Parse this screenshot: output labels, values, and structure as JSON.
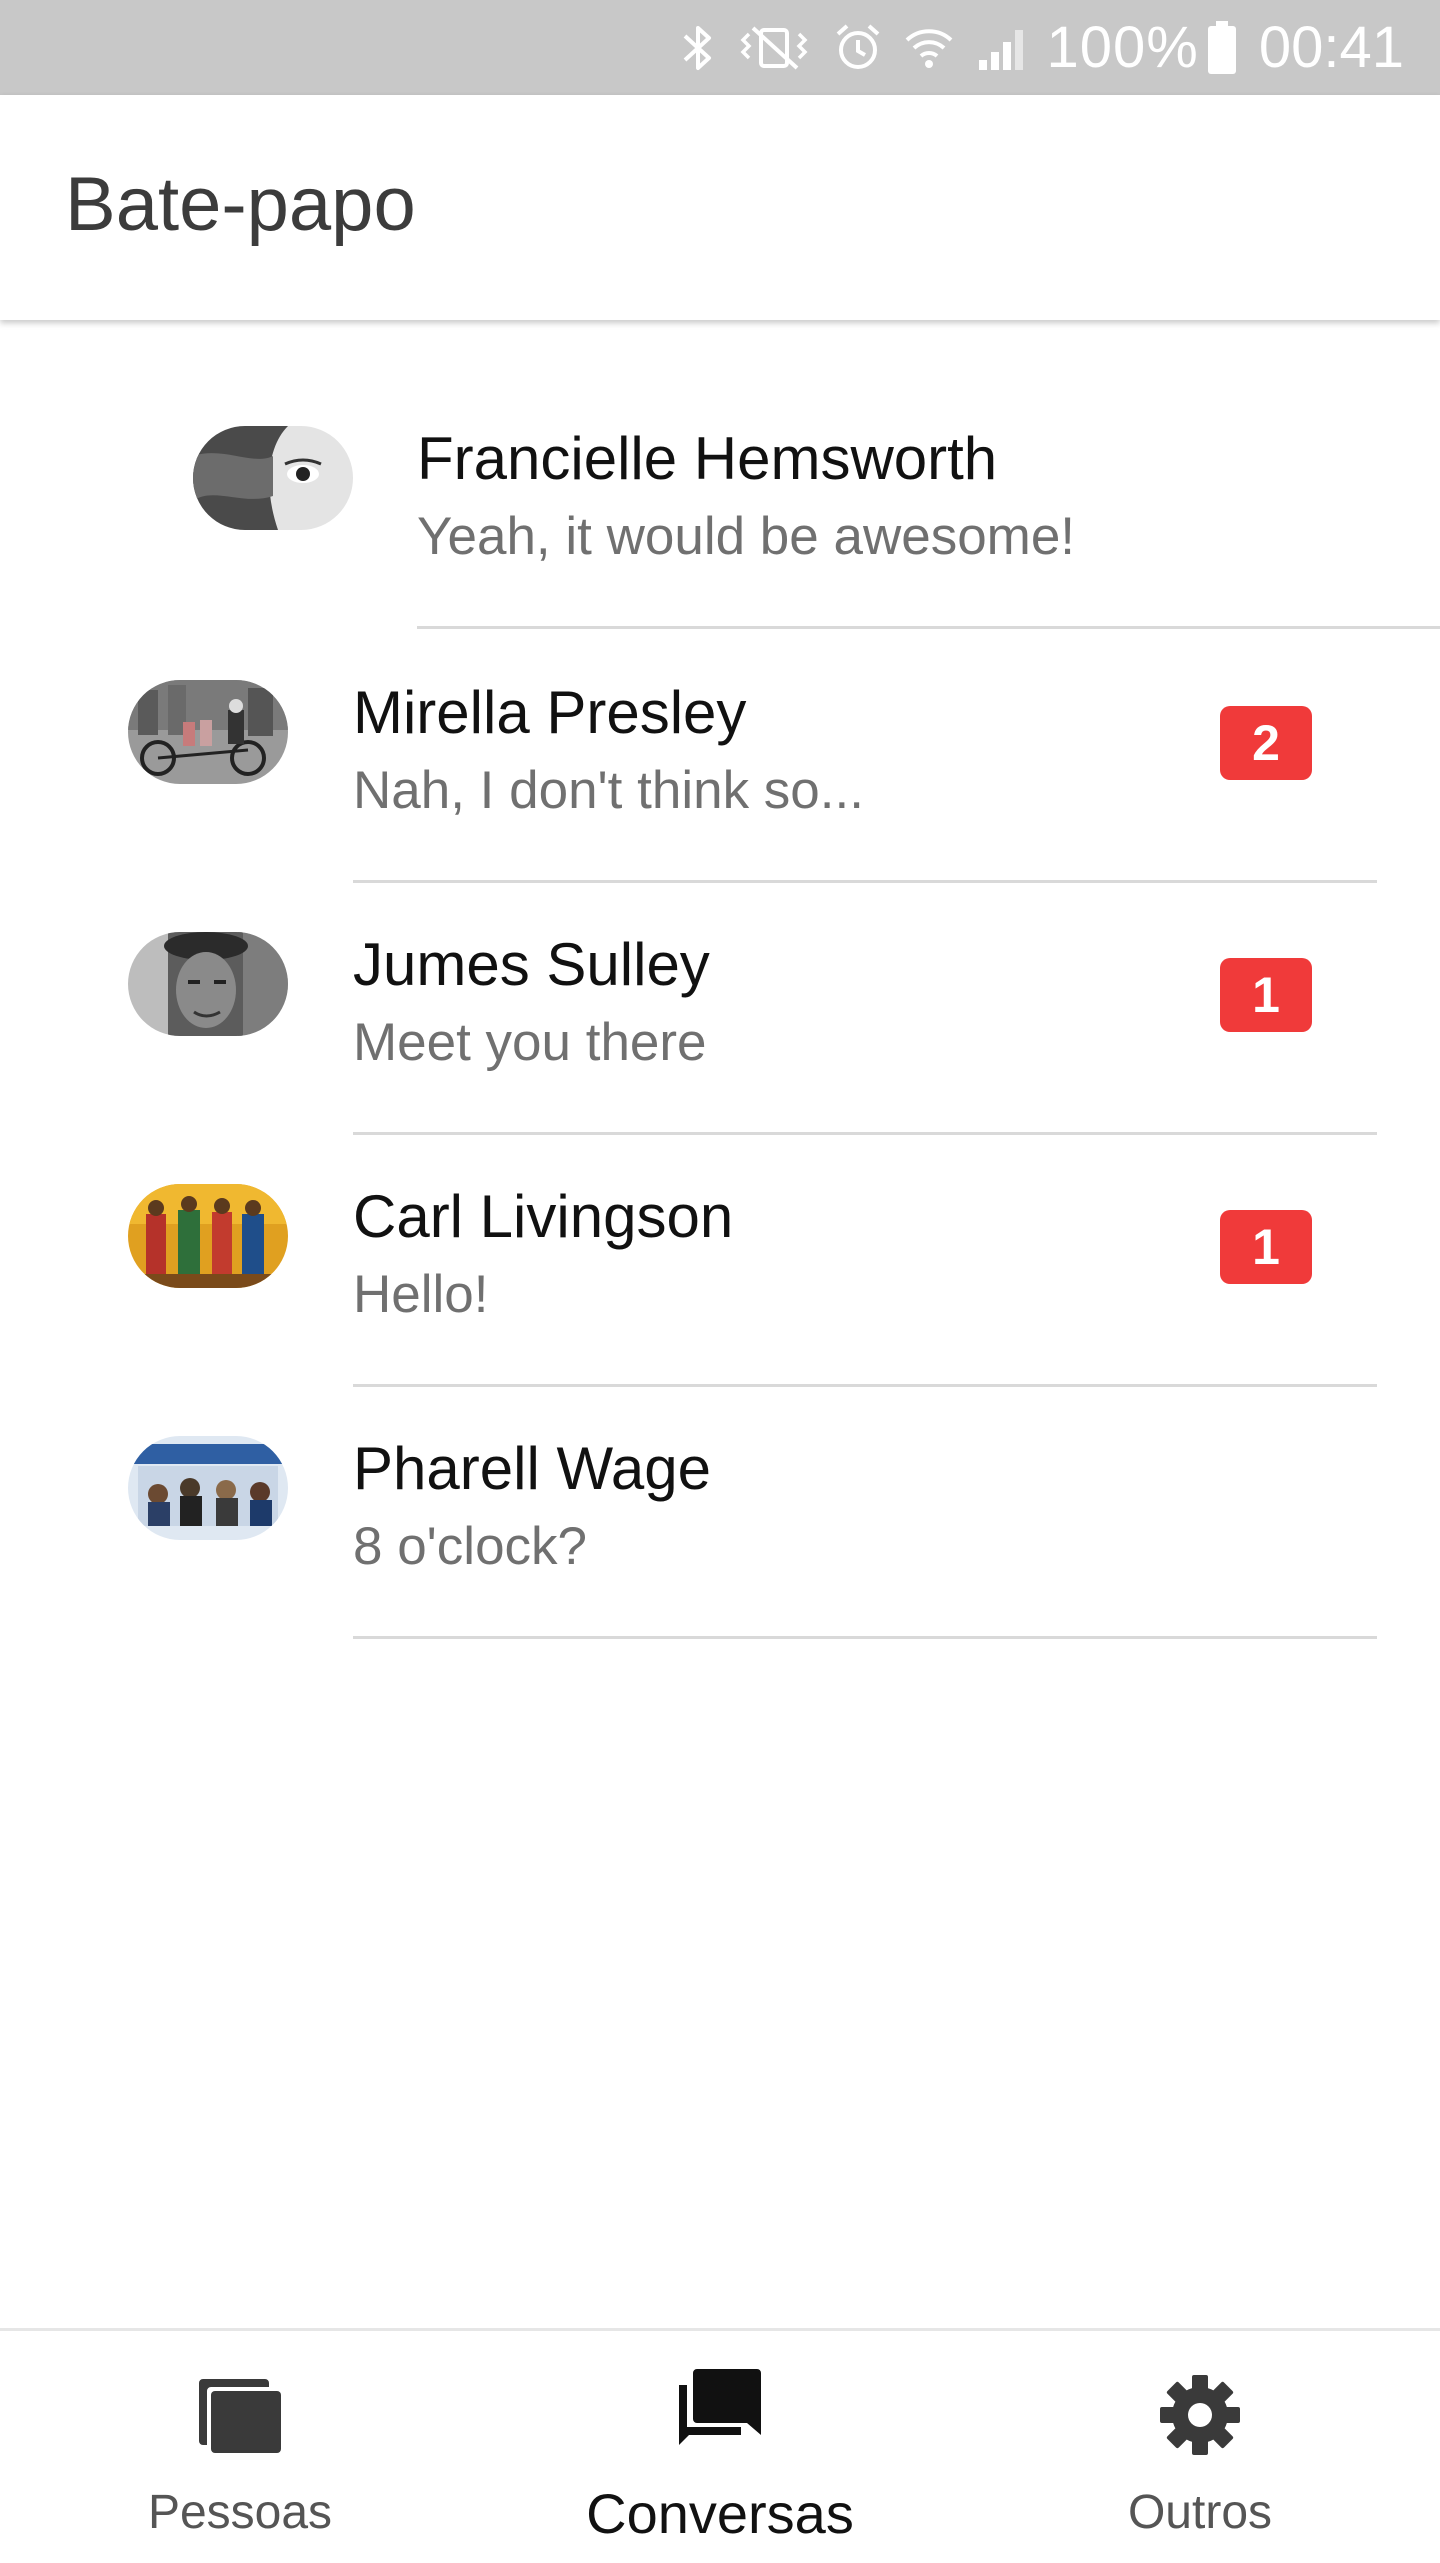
{
  "status_bar": {
    "battery_percent": "100%",
    "time": "00:41",
    "icons": [
      "bluetooth-icon",
      "vibrate-icon",
      "alarm-icon",
      "wifi-icon",
      "signal-icon",
      "battery-icon"
    ]
  },
  "app_bar": {
    "title": "Bate-papo"
  },
  "conversations": [
    {
      "name": "Francielle Hemsworth",
      "preview": "Yeah, it would be awesome!",
      "unread": null
    },
    {
      "name": "Mirella Presley",
      "preview": "Nah, I don't think so...",
      "unread": "2"
    },
    {
      "name": "Jumes Sulley",
      "preview": "Meet you there",
      "unread": "1"
    },
    {
      "name": "Carl Livingson",
      "preview": "Hello!",
      "unread": "1"
    },
    {
      "name": "Pharell Wage",
      "preview": "8 o'clock?",
      "unread": null
    }
  ],
  "bottom_nav": {
    "tabs": [
      {
        "label": "Pessoas",
        "icon": "people-stack-icon",
        "active": false
      },
      {
        "label": "Conversas",
        "icon": "chat-icon",
        "active": true
      },
      {
        "label": "Outros",
        "icon": "gear-icon",
        "active": false
      }
    ]
  },
  "colors": {
    "status_bar": "#c8c8c8",
    "badge": "#f03a3a",
    "divider": "#d9d9d9",
    "icon": "#333333"
  }
}
